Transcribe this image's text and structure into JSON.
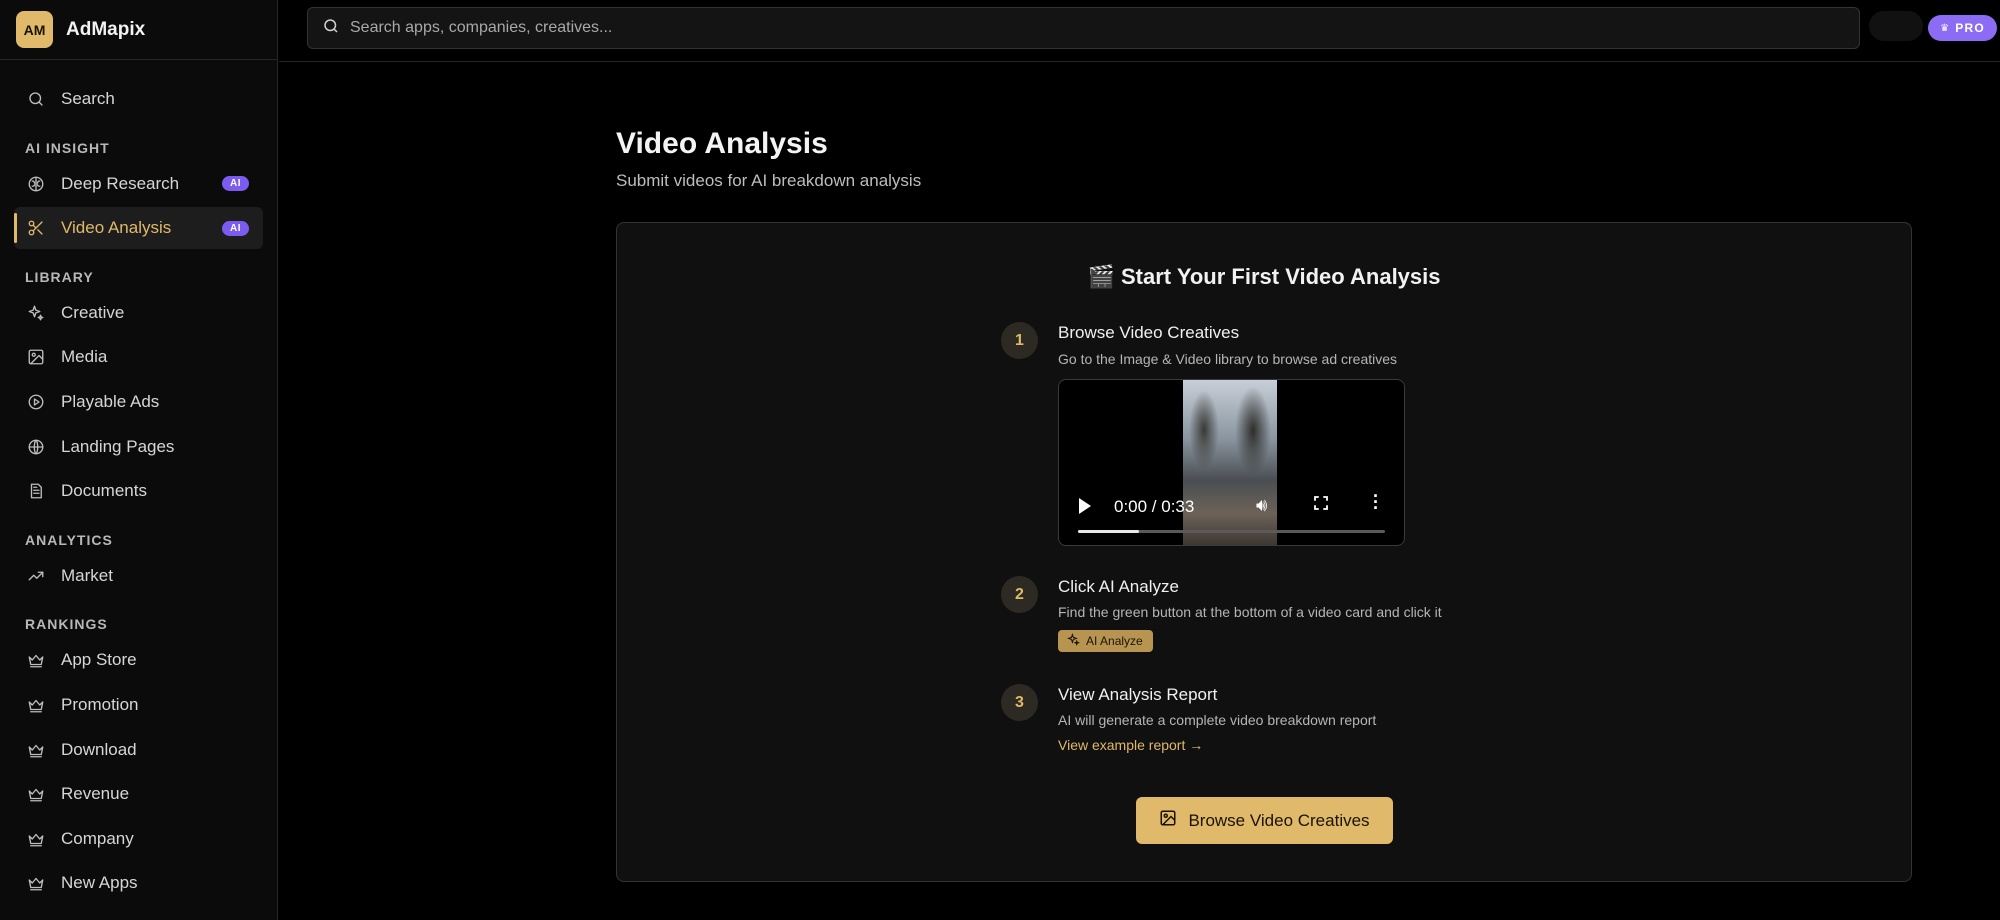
{
  "brand": {
    "logo_text": "AM",
    "name": "AdMapix",
    "logo_color": "#e0b96a"
  },
  "search": {
    "placeholder": "Search apps, companies, creatives..."
  },
  "topbar": {
    "pro_label": "PRO",
    "pro_color": "#8d6cf5"
  },
  "sidebar": {
    "search_label": "Search",
    "sections": [
      {
        "label": "AI INSIGHT",
        "items": [
          {
            "label": "Deep Research",
            "icon": "brain-icon",
            "badge": "AI"
          },
          {
            "label": "Video Analysis",
            "icon": "scissors-icon",
            "badge": "AI",
            "active": true
          }
        ]
      },
      {
        "label": "LIBRARY",
        "items": [
          {
            "label": "Creative",
            "icon": "sparkles-icon"
          },
          {
            "label": "Media",
            "icon": "image-icon"
          },
          {
            "label": "Playable Ads",
            "icon": "play-circle-icon"
          },
          {
            "label": "Landing Pages",
            "icon": "globe-icon"
          },
          {
            "label": "Documents",
            "icon": "document-icon"
          }
        ]
      },
      {
        "label": "ANALYTICS",
        "items": [
          {
            "label": "Market",
            "icon": "trending-up-icon"
          }
        ]
      },
      {
        "label": "RANKINGS",
        "items": [
          {
            "label": "App Store",
            "icon": "crown-icon"
          },
          {
            "label": "Promotion",
            "icon": "crown-icon"
          },
          {
            "label": "Download",
            "icon": "crown-icon"
          },
          {
            "label": "Revenue",
            "icon": "crown-icon"
          },
          {
            "label": "Company",
            "icon": "crown-icon"
          },
          {
            "label": "New Apps",
            "icon": "crown-icon"
          }
        ]
      }
    ]
  },
  "page": {
    "title": "Video Analysis",
    "subtitle": "Submit videos for AI breakdown analysis"
  },
  "card": {
    "title": "🎬 Start Your First Video Analysis",
    "steps": [
      {
        "num": "1",
        "title": "Browse Video Creatives",
        "desc": "Go to the Image & Video library to browse ad creatives"
      },
      {
        "num": "2",
        "title": "Click AI Analyze",
        "desc": "Find the green button at the bottom of a video card and click it"
      },
      {
        "num": "3",
        "title": "View Analysis Report",
        "desc": "AI will generate a complete video breakdown report"
      }
    ],
    "video": {
      "time": "0:00 / 0:33",
      "progress_fraction": 0.2
    },
    "ai_chip_label": "AI Analyze",
    "example_link": "View example report →",
    "cta_label": "Browse Video Creatives",
    "accent": "#e0b96a"
  }
}
